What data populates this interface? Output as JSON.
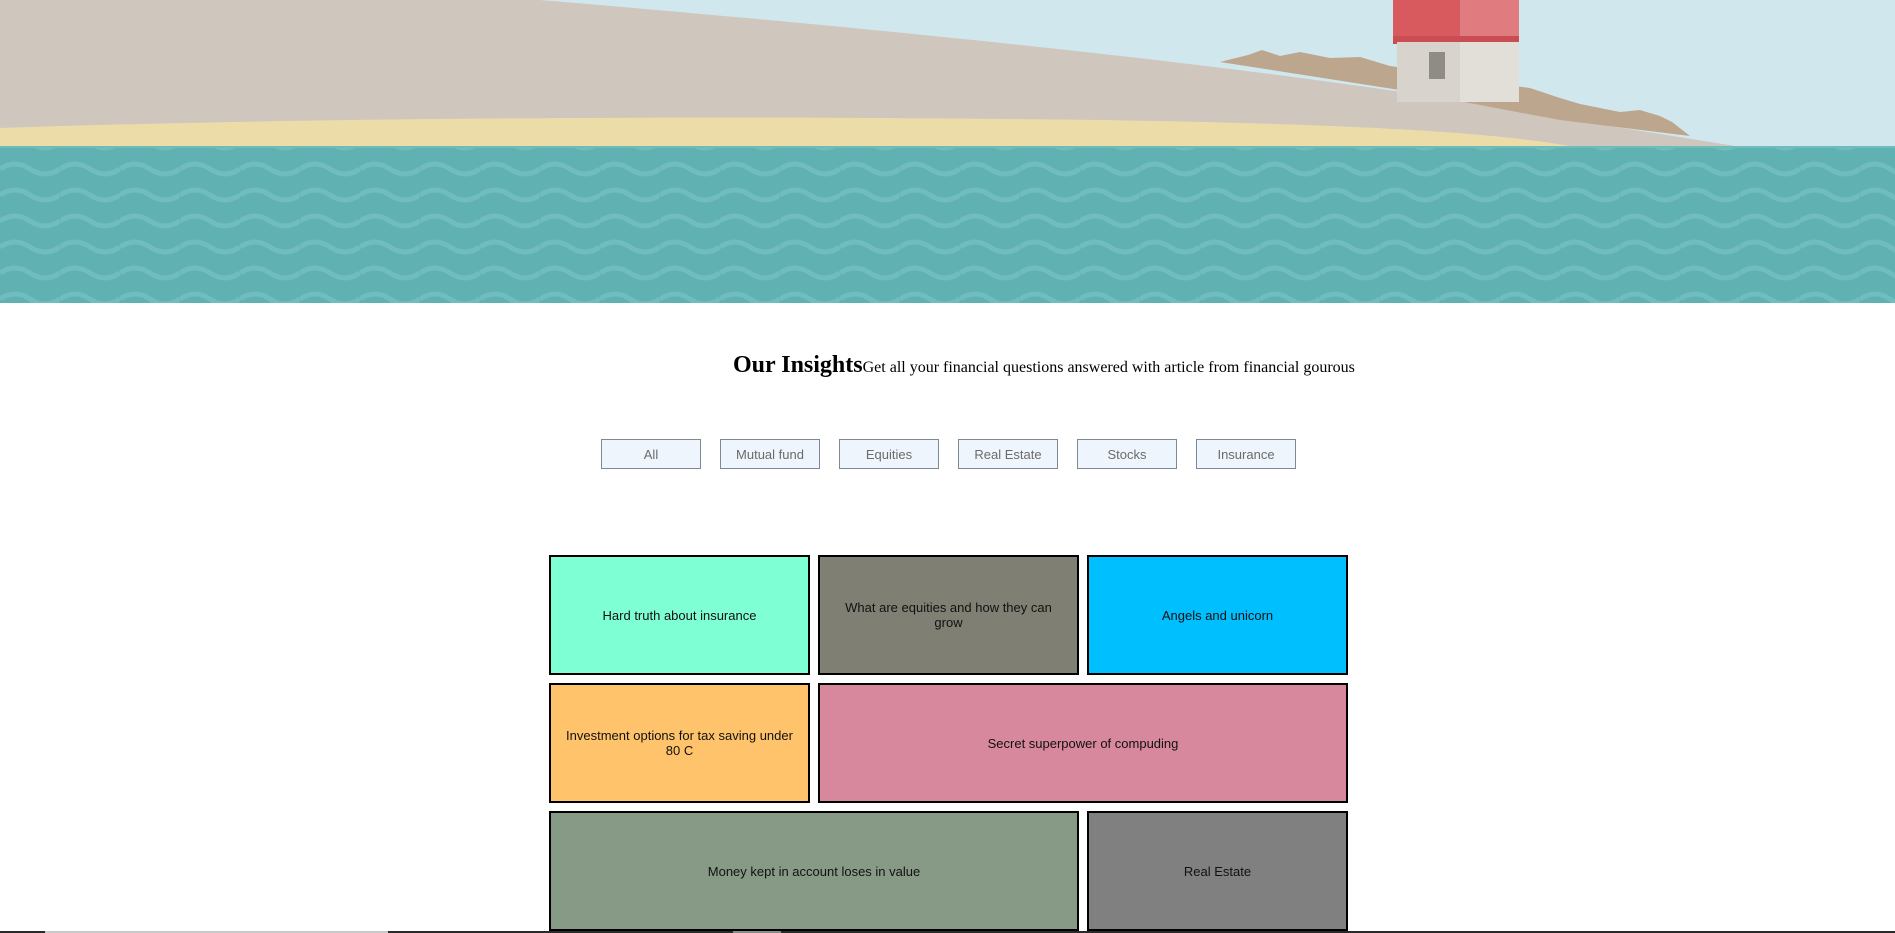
{
  "hero": {
    "scene": "lighthouse-seaside-illustration",
    "colors": {
      "sky": "#d1e7ee",
      "hill": "#cfc6be",
      "sand": "#ecdda8",
      "sea": "#5fb1b2",
      "wave": "#77c0c0",
      "lighthouse_red": "#d85a5f",
      "lighthouse_wall": "#d8d4cd",
      "rocks": "#bda68e"
    }
  },
  "insights": {
    "title": "Our Insights",
    "subtitle": "Get all your financial questions answered with article from financial gourous"
  },
  "filters": [
    {
      "label": "All"
    },
    {
      "label": "Mutual fund"
    },
    {
      "label": "Equities"
    },
    {
      "label": "Real Estate"
    },
    {
      "label": "Stocks"
    },
    {
      "label": "Insurance"
    }
  ],
  "cards": [
    {
      "title": "Hard truth about insurance",
      "color": "#7fffd4"
    },
    {
      "title": "What are equities and how they can grow",
      "color": "#807f74"
    },
    {
      "title": "Angels and unicorn",
      "color": "#00bfff"
    },
    {
      "title": "Investment options for tax saving under 80 C",
      "color": "#ffc36b"
    },
    {
      "title": "Secret superpower of compuding",
      "color": "#d7889d"
    },
    {
      "title": "Money kept in account loses in value",
      "color": "#879a86"
    },
    {
      "title": "Real Estate",
      "color": "#808080"
    }
  ]
}
